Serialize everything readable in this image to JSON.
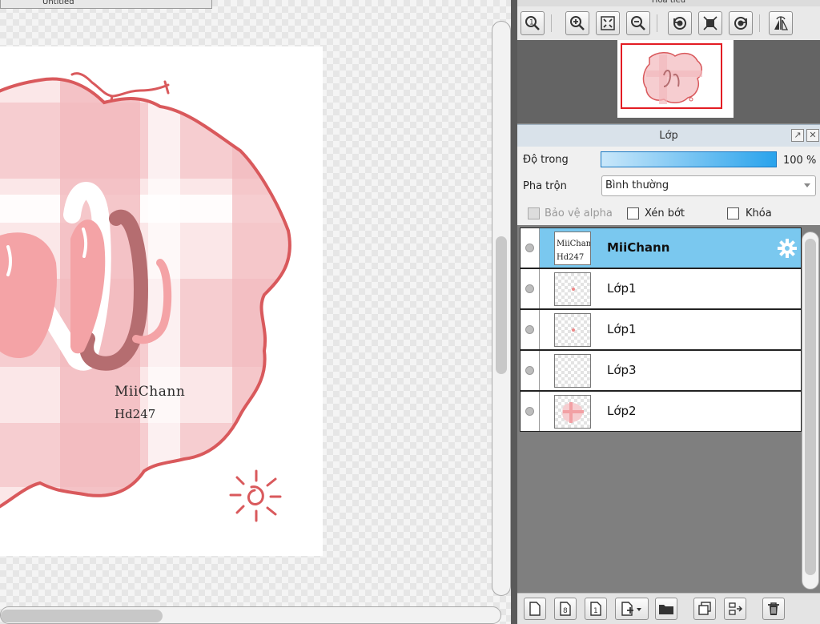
{
  "canvas": {
    "doc_tab_title": "Untitled",
    "logo_line1": "MiiChann",
    "logo_line2": "Hd247"
  },
  "navigator": {
    "title": "Hoa tiêu",
    "toolbar": [
      {
        "name": "zoom-reset-icon"
      },
      {
        "name": "zoom-in-icon"
      },
      {
        "name": "fit-screen-icon"
      },
      {
        "name": "zoom-out-icon"
      },
      {
        "name": "rotate-left-icon"
      },
      {
        "name": "fit-canvas-icon"
      },
      {
        "name": "rotate-right-icon"
      },
      {
        "name": "flip-horizontal-icon"
      }
    ]
  },
  "layers_panel": {
    "title": "Lớp",
    "opacity_label": "Độ trong",
    "opacity_value": "100 %",
    "opacity_fraction": 1.0,
    "blend_label": "Pha trộn",
    "blend_value": "Bình thường",
    "protect_alpha_label": "Bảo vệ alpha",
    "clipping_label": "Xén bớt",
    "lock_label": "Khóa",
    "layers": [
      {
        "name": "MiiChann",
        "selected": true,
        "thumb": "text"
      },
      {
        "name": "Lớp1",
        "selected": false,
        "thumb": "dot"
      },
      {
        "name": "Lớp1",
        "selected": false,
        "thumb": "dot"
      },
      {
        "name": "Lớp3",
        "selected": false,
        "thumb": "empty"
      },
      {
        "name": "Lớp2",
        "selected": false,
        "thumb": "grid"
      }
    ]
  },
  "colors": {
    "accent_blue": "#29a3ec",
    "selected_row": "#7ac8ef",
    "nav_frame": "#e31c23",
    "art_pink": "#f4a3a6",
    "art_outline": "#d9595c"
  }
}
